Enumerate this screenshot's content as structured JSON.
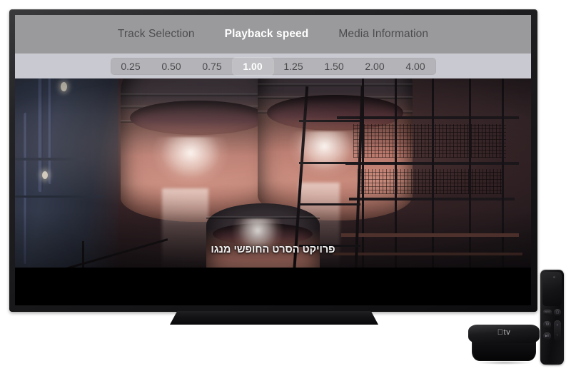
{
  "device": {
    "tv_label": "television",
    "stand_label": "tv-stand",
    "apple_tv_logo": "tv",
    "remote_label": "siri-remote"
  },
  "menu": {
    "items": [
      {
        "label": "Track Selection",
        "active": false
      },
      {
        "label": "Playback speed",
        "active": true
      },
      {
        "label": "Media Information",
        "active": false
      }
    ]
  },
  "playback_speed": {
    "selected": "1.00",
    "options": [
      "0.25",
      "0.50",
      "0.75",
      "1.00",
      "1.25",
      "1.50",
      "2.00",
      "4.00"
    ]
  },
  "video": {
    "subtitle": "פרויקט הסרט החופשי מנגו",
    "scene_description": "industrial blast furnace towers"
  },
  "remote": {
    "buttons": [
      {
        "name": "menu-button",
        "label": "MENU"
      },
      {
        "name": "tv-home-button",
        "label": "▢"
      },
      {
        "name": "siri-button",
        "label": "Ἱ9"
      },
      {
        "name": "play-pause-button",
        "label": "▶‖"
      },
      {
        "name": "volume-up-button",
        "label": "+"
      },
      {
        "name": "volume-down-button",
        "label": "−"
      }
    ]
  },
  "colors": {
    "menubar_bg": "#9a9a9c",
    "speedbar_bg": "#c9c9d1",
    "pill_bg": "#b4b4b8",
    "selected_text": "#ffffff",
    "inactive_text": "#4d4d4f",
    "page_bg": "#ffffff"
  }
}
